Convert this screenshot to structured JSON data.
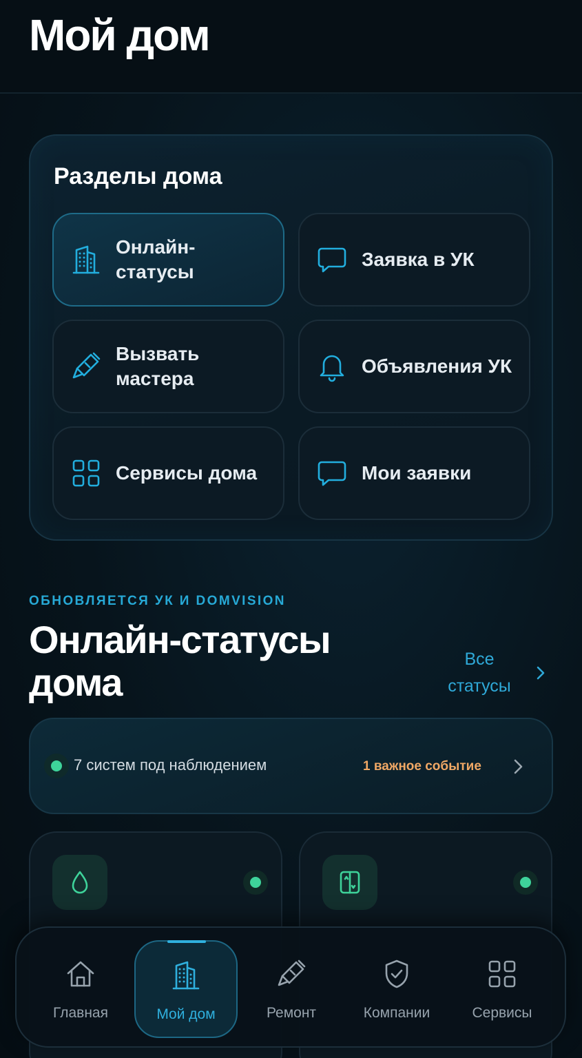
{
  "header": {
    "title": "Мой дом"
  },
  "sections": {
    "title": "Разделы дома",
    "tiles": [
      {
        "label": "Онлайн-статусы",
        "icon": "building-icon",
        "active": true
      },
      {
        "label": "Заявка в УК",
        "icon": "chat-bubble-icon",
        "active": false
      },
      {
        "label": "Вызвать мастера",
        "icon": "wrench-icon",
        "active": false
      },
      {
        "label": "Объявления УК",
        "icon": "bell-icon",
        "active": false
      },
      {
        "label": "Сервисы дома",
        "icon": "grid-icon",
        "active": false
      },
      {
        "label": "Мои заявки",
        "icon": "chat-bubble-icon",
        "active": false
      }
    ]
  },
  "statuses": {
    "kicker": "ОБНОВЛЯЕТСЯ УК И DOMVISION",
    "title": "Онлайн-статусы дома",
    "all_link": "Все статусы",
    "summary": {
      "systems_text": "7 систем под наблюдением",
      "event_text": "1 важное событие"
    },
    "cards": [
      {
        "icon": "water-drop-icon",
        "status": "ok"
      },
      {
        "icon": "elevator-icon",
        "status": "ok"
      }
    ]
  },
  "nav": {
    "items": [
      {
        "label": "Главная",
        "icon": "home-icon",
        "active": false
      },
      {
        "label": "Мой дом",
        "icon": "building-icon",
        "active": true
      },
      {
        "label": "Ремонт",
        "icon": "wrench-icon",
        "active": false
      },
      {
        "label": "Компании",
        "icon": "shield-check-icon",
        "active": false
      },
      {
        "label": "Сервисы",
        "icon": "grid-icon",
        "active": false
      }
    ]
  },
  "colors": {
    "accent": "#2FB0DE",
    "status_ok": "#3ED39A",
    "warning": "#F0A865",
    "background": "#07131B"
  }
}
